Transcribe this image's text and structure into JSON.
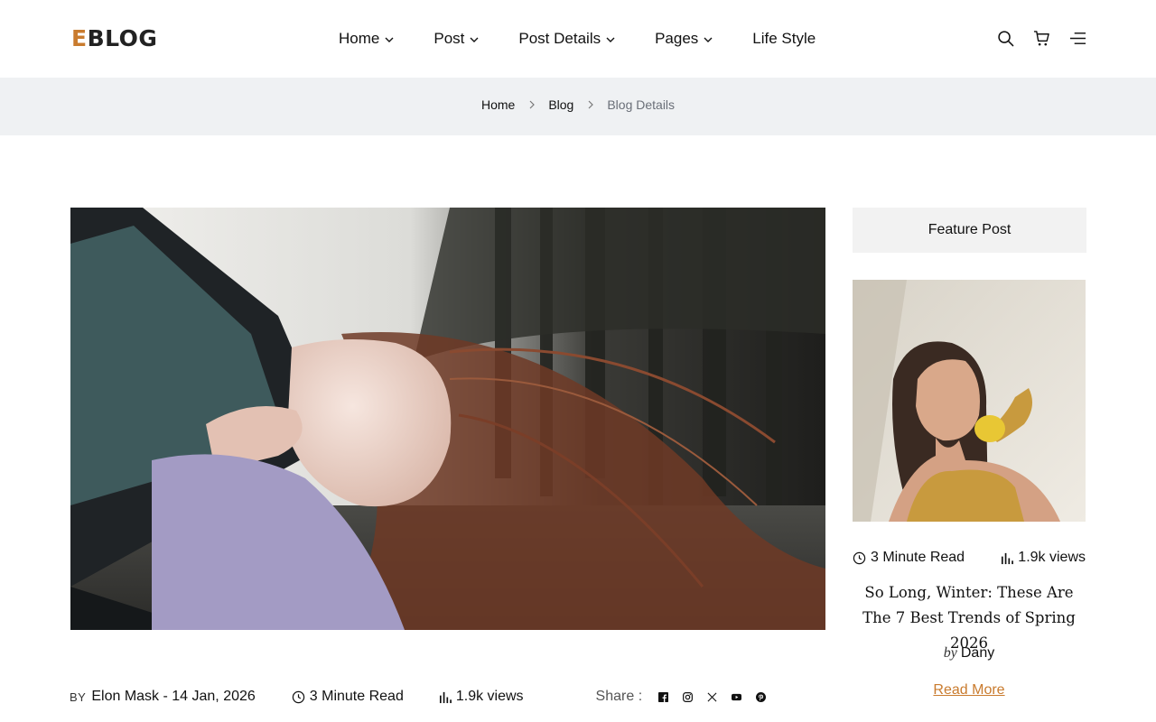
{
  "header": {
    "logo_accent": "E",
    "logo_rest": "BLOG",
    "nav": [
      {
        "label": "Home",
        "has_dropdown": true
      },
      {
        "label": "Post",
        "has_dropdown": true
      },
      {
        "label": "Post Details",
        "has_dropdown": true
      },
      {
        "label": "Pages",
        "has_dropdown": true
      },
      {
        "label": "Life Style",
        "has_dropdown": false
      }
    ],
    "icons": [
      "search-icon",
      "cart-icon",
      "menu-icon"
    ]
  },
  "breadcrumb": [
    "Home",
    "Blog",
    "Blog Details"
  ],
  "post": {
    "by_label": "BY",
    "author_date": "Elon Mask - 14 Jan, 2026",
    "read_time": "3 Minute Read",
    "views": "1.9k views",
    "share_label": "Share :",
    "social_icons": [
      "facebook-icon",
      "instagram-icon",
      "x-icon",
      "youtube-icon",
      "pinterest-icon"
    ]
  },
  "sidebar": {
    "title": "Feature Post",
    "read_time": "3 Minute Read",
    "views": "1.9k views",
    "headline": "So Long, Winter: These Are The 7 Best Trends of Spring 2026",
    "by_word": "by",
    "author": "Dany",
    "read_more": "Read More"
  },
  "colors": {
    "accent": "#c97b2e",
    "band": "#eff1f3",
    "sidebar_title_bg": "#f2f2f2"
  }
}
